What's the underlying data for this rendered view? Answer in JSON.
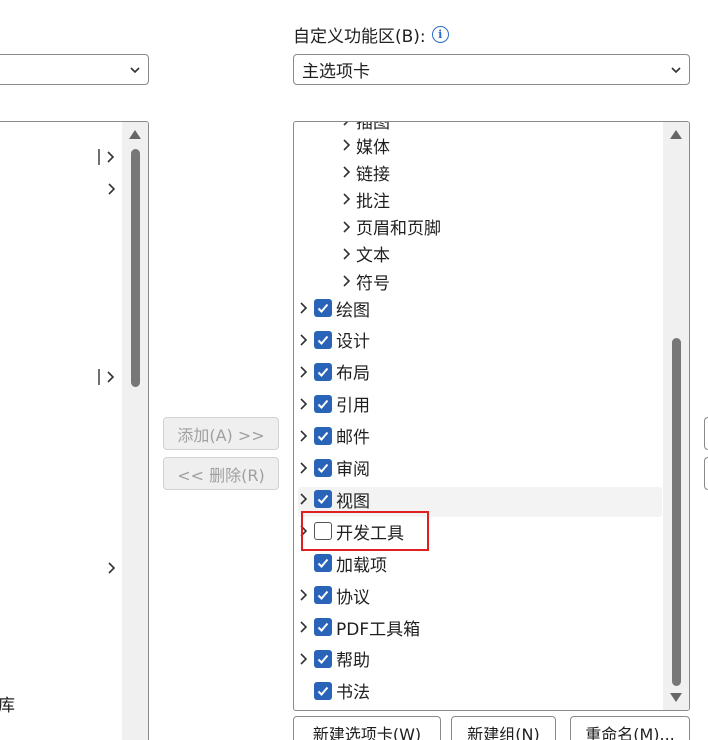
{
  "right_label": "自定义功能区(B):",
  "right_label_prefix": "自定义功能区(",
  "right_label_key": "B",
  "right_label_suffix": "):",
  "left_select": {
    "value": ""
  },
  "right_select": {
    "value": "主选项卡"
  },
  "left_panel": {
    "partial_text": "库"
  },
  "tree": {
    "partial_top": "插图",
    "groups": [
      "媒体",
      "链接",
      "批注",
      "页眉和页脚",
      "文本",
      "符号"
    ],
    "tabs": [
      {
        "label": "绘图",
        "checked": true,
        "expandable": true
      },
      {
        "label": "设计",
        "checked": true,
        "expandable": true
      },
      {
        "label": "布局",
        "checked": true,
        "expandable": true
      },
      {
        "label": "引用",
        "checked": true,
        "expandable": true
      },
      {
        "label": "邮件",
        "checked": true,
        "expandable": true
      },
      {
        "label": "审阅",
        "checked": true,
        "expandable": true
      },
      {
        "label": "视图",
        "checked": true,
        "expandable": true
      },
      {
        "label": "开发工具",
        "checked": false,
        "expandable": true
      },
      {
        "label": "加载项",
        "checked": true,
        "expandable": false
      },
      {
        "label": "协议",
        "checked": true,
        "expandable": true
      },
      {
        "label": "PDF工具箱",
        "checked": true,
        "expandable": true
      },
      {
        "label": "帮助",
        "checked": true,
        "expandable": true
      },
      {
        "label": "书法",
        "checked": true,
        "expandable": false
      }
    ]
  },
  "buttons": {
    "add": "添加(A) >>",
    "remove": "<< 删除(R)",
    "new_tab": "新建选项卡(W)",
    "new_group": "新建组(N)",
    "rename": "重命名(M)..."
  },
  "colors": {
    "accent": "#2a64b8",
    "highlight_box": "#e02020",
    "info": "#2b6cc4"
  }
}
